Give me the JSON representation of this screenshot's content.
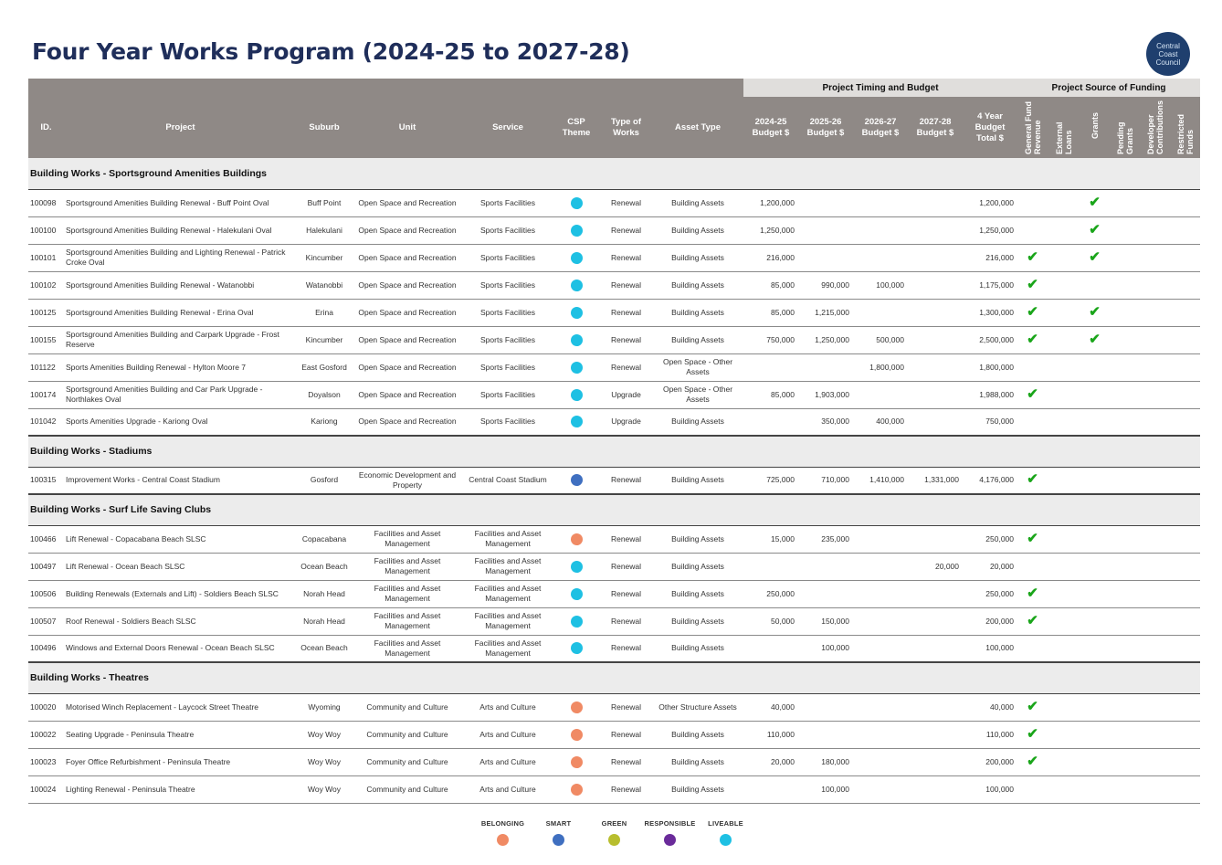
{
  "title": "Four Year Works Program (2024-25 to 2027-28)",
  "logo_text": "Central Coast Council",
  "groups": {
    "timing": "Project Timing and Budget",
    "funding": "Project Source of Funding"
  },
  "headers": {
    "id": "ID.",
    "project": "Project",
    "suburb": "Suburb",
    "unit": "Unit",
    "service": "Service",
    "csp": "CSP Theme",
    "type": "Type of Works",
    "asset": "Asset Type",
    "b1": "2024-25 Budget $",
    "b2": "2025-26 Budget $",
    "b3": "2026-27 Budget $",
    "b4": "2027-28 Budget $",
    "total": "4 Year Budget Total $",
    "f_general": "General Fund Revenue",
    "f_loans": "External Loans",
    "f_grants": "Grants",
    "f_pending": "Pending Grants",
    "f_developer": "Developer Contributions",
    "f_restricted": "Restricted Funds"
  },
  "colors": {
    "BELONGING": "#f08a64",
    "SMART": "#3f6fc0",
    "GREEN": "#b8be2e",
    "RESPONSIBLE": "#6a2b9a",
    "LIVEABLE": "#1ec0e3",
    "tick": "#1aa51a"
  },
  "tick_symbol": "✔",
  "sections": [
    {
      "title": "Building Works - Sportsground Amenities Buildings",
      "rows": [
        {
          "id": "100098",
          "project": "Sportsground Amenities Building Renewal - Buff Point Oval",
          "suburb": "Buff Point",
          "unit": "Open Space and Recreation",
          "service": "Sports Facilities",
          "csp": "LIVEABLE",
          "type": "Renewal",
          "asset": "Building Assets",
          "b1": "1,200,000",
          "b2": "",
          "b3": "",
          "b4": "",
          "total": "1,200,000",
          "funding": [
            false,
            false,
            true,
            false,
            false,
            false
          ]
        },
        {
          "id": "100100",
          "project": "Sportsground Amenities Building Renewal - Halekulani Oval",
          "suburb": "Halekulani",
          "unit": "Open Space and Recreation",
          "service": "Sports Facilities",
          "csp": "LIVEABLE",
          "type": "Renewal",
          "asset": "Building Assets",
          "b1": "1,250,000",
          "b2": "",
          "b3": "",
          "b4": "",
          "total": "1,250,000",
          "funding": [
            false,
            false,
            true,
            false,
            false,
            false
          ]
        },
        {
          "id": "100101",
          "project": "Sportsground Amenities Building and Lighting Renewal - Patrick Croke Oval",
          "suburb": "Kincumber",
          "unit": "Open Space and Recreation",
          "service": "Sports Facilities",
          "csp": "LIVEABLE",
          "type": "Renewal",
          "asset": "Building Assets",
          "b1": "216,000",
          "b2": "",
          "b3": "",
          "b4": "",
          "total": "216,000",
          "funding": [
            true,
            false,
            true,
            false,
            false,
            false
          ]
        },
        {
          "id": "100102",
          "project": "Sportsground Amenities Building Renewal - Watanobbi",
          "suburb": "Watanobbi",
          "unit": "Open Space and Recreation",
          "service": "Sports Facilities",
          "csp": "LIVEABLE",
          "type": "Renewal",
          "asset": "Building Assets",
          "b1": "85,000",
          "b2": "990,000",
          "b3": "100,000",
          "b4": "",
          "total": "1,175,000",
          "funding": [
            true,
            false,
            false,
            false,
            false,
            false
          ]
        },
        {
          "id": "100125",
          "project": "Sportsground Amenities Building Renewal - Erina Oval",
          "suburb": "Erina",
          "unit": "Open Space and Recreation",
          "service": "Sports Facilities",
          "csp": "LIVEABLE",
          "type": "Renewal",
          "asset": "Building Assets",
          "b1": "85,000",
          "b2": "1,215,000",
          "b3": "",
          "b4": "",
          "total": "1,300,000",
          "funding": [
            true,
            false,
            true,
            false,
            false,
            false
          ]
        },
        {
          "id": "100155",
          "project": "Sportsground Amenities Building and Carpark Upgrade - Frost Reserve",
          "suburb": "Kincumber",
          "unit": "Open Space and Recreation",
          "service": "Sports Facilities",
          "csp": "LIVEABLE",
          "type": "Renewal",
          "asset": "Building Assets",
          "b1": "750,000",
          "b2": "1,250,000",
          "b3": "500,000",
          "b4": "",
          "total": "2,500,000",
          "funding": [
            true,
            false,
            true,
            false,
            false,
            false
          ]
        },
        {
          "id": "101122",
          "project": "Sports Amenities Building Renewal - Hylton Moore 7",
          "suburb": "East Gosford",
          "unit": "Open Space and Recreation",
          "service": "Sports Facilities",
          "csp": "LIVEABLE",
          "type": "Renewal",
          "asset": "Open Space - Other Assets",
          "b1": "",
          "b2": "",
          "b3": "1,800,000",
          "b4": "",
          "total": "1,800,000",
          "funding": [
            false,
            false,
            false,
            false,
            false,
            false
          ]
        },
        {
          "id": "100174",
          "project": "Sportsground Amenities Building and Car Park Upgrade - Northlakes Oval",
          "suburb": "Doyalson",
          "unit": "Open Space and Recreation",
          "service": "Sports Facilities",
          "csp": "LIVEABLE",
          "type": "Upgrade",
          "asset": "Open Space - Other Assets",
          "b1": "85,000",
          "b2": "1,903,000",
          "b3": "",
          "b4": "",
          "total": "1,988,000",
          "funding": [
            true,
            false,
            false,
            false,
            false,
            false
          ]
        },
        {
          "id": "101042",
          "project": "Sports Amenities Upgrade - Kariong Oval",
          "suburb": "Kariong",
          "unit": "Open Space and Recreation",
          "service": "Sports Facilities",
          "csp": "LIVEABLE",
          "type": "Upgrade",
          "asset": "Building Assets",
          "b1": "",
          "b2": "350,000",
          "b3": "400,000",
          "b4": "",
          "total": "750,000",
          "funding": [
            false,
            false,
            false,
            false,
            false,
            false
          ]
        }
      ]
    },
    {
      "title": "Building Works - Stadiums",
      "rows": [
        {
          "id": "100315",
          "project": "Improvement Works - Central Coast Stadium",
          "suburb": "Gosford",
          "unit": "Economic Development and Property",
          "service": "Central Coast Stadium",
          "csp": "SMART",
          "type": "Renewal",
          "asset": "Building Assets",
          "b1": "725,000",
          "b2": "710,000",
          "b3": "1,410,000",
          "b4": "1,331,000",
          "total": "4,176,000",
          "funding": [
            true,
            false,
            false,
            false,
            false,
            false
          ]
        }
      ]
    },
    {
      "title": "Building Works - Surf Life Saving Clubs",
      "rows": [
        {
          "id": "100466",
          "project": "Lift Renewal - Copacabana Beach SLSC",
          "suburb": "Copacabana",
          "unit": "Facilities and Asset Management",
          "service": "Facilities and Asset Management",
          "csp": "BELONGING",
          "type": "Renewal",
          "asset": "Building Assets",
          "b1": "15,000",
          "b2": "235,000",
          "b3": "",
          "b4": "",
          "total": "250,000",
          "funding": [
            true,
            false,
            false,
            false,
            false,
            false
          ]
        },
        {
          "id": "100497",
          "project": "Lift Renewal - Ocean Beach SLSC",
          "suburb": "Ocean Beach",
          "unit": "Facilities and Asset Management",
          "service": "Facilities and Asset Management",
          "csp": "LIVEABLE",
          "type": "Renewal",
          "asset": "Building Assets",
          "b1": "",
          "b2": "",
          "b3": "",
          "b4": "20,000",
          "total": "20,000",
          "funding": [
            false,
            false,
            false,
            false,
            false,
            false
          ]
        },
        {
          "id": "100506",
          "project": "Building Renewals (Externals and Lift) - Soldiers Beach SLSC",
          "suburb": "Norah Head",
          "unit": "Facilities and Asset Management",
          "service": "Facilities and Asset Management",
          "csp": "LIVEABLE",
          "type": "Renewal",
          "asset": "Building Assets",
          "b1": "250,000",
          "b2": "",
          "b3": "",
          "b4": "",
          "total": "250,000",
          "funding": [
            true,
            false,
            false,
            false,
            false,
            false
          ]
        },
        {
          "id": "100507",
          "project": "Roof Renewal - Soldiers Beach SLSC",
          "suburb": "Norah Head",
          "unit": "Facilities and Asset Management",
          "service": "Facilities and Asset Management",
          "csp": "LIVEABLE",
          "type": "Renewal",
          "asset": "Building Assets",
          "b1": "50,000",
          "b2": "150,000",
          "b3": "",
          "b4": "",
          "total": "200,000",
          "funding": [
            true,
            false,
            false,
            false,
            false,
            false
          ]
        },
        {
          "id": "100496",
          "project": "Windows and External Doors Renewal - Ocean Beach SLSC",
          "suburb": "Ocean Beach",
          "unit": "Facilities and Asset Management",
          "service": "Facilities and Asset Management",
          "csp": "LIVEABLE",
          "type": "Renewal",
          "asset": "Building Assets",
          "b1": "",
          "b2": "100,000",
          "b3": "",
          "b4": "",
          "total": "100,000",
          "funding": [
            false,
            false,
            false,
            false,
            false,
            false
          ]
        }
      ]
    },
    {
      "title": "Building Works - Theatres",
      "rows": [
        {
          "id": "100020",
          "project": "Motorised Winch Replacement - Laycock Street Theatre",
          "suburb": "Wyoming",
          "unit": "Community and Culture",
          "service": "Arts and Culture",
          "csp": "BELONGING",
          "type": "Renewal",
          "asset": "Other Structure Assets",
          "b1": "40,000",
          "b2": "",
          "b3": "",
          "b4": "",
          "total": "40,000",
          "funding": [
            true,
            false,
            false,
            false,
            false,
            false
          ]
        },
        {
          "id": "100022",
          "project": "Seating Upgrade - Peninsula Theatre",
          "suburb": "Woy Woy",
          "unit": "Community and Culture",
          "service": "Arts and Culture",
          "csp": "BELONGING",
          "type": "Renewal",
          "asset": "Building Assets",
          "b1": "110,000",
          "b2": "",
          "b3": "",
          "b4": "",
          "total": "110,000",
          "funding": [
            true,
            false,
            false,
            false,
            false,
            false
          ]
        },
        {
          "id": "100023",
          "project": "Foyer Office Refurbishment - Peninsula Theatre",
          "suburb": "Woy Woy",
          "unit": "Community and Culture",
          "service": "Arts and Culture",
          "csp": "BELONGING",
          "type": "Renewal",
          "asset": "Building Assets",
          "b1": "20,000",
          "b2": "180,000",
          "b3": "",
          "b4": "",
          "total": "200,000",
          "funding": [
            true,
            false,
            false,
            false,
            false,
            false
          ]
        },
        {
          "id": "100024",
          "project": "Lighting Renewal - Peninsula Theatre",
          "suburb": "Woy Woy",
          "unit": "Community and Culture",
          "service": "Arts and Culture",
          "csp": "BELONGING",
          "type": "Renewal",
          "asset": "Building Assets",
          "b1": "",
          "b2": "100,000",
          "b3": "",
          "b4": "",
          "total": "100,000",
          "funding": [
            false,
            false,
            false,
            false,
            false,
            false
          ]
        }
      ]
    }
  ],
  "legend": [
    {
      "label": "BELONGING",
      "color": "#f08a64"
    },
    {
      "label": "SMART",
      "color": "#3f6fc0"
    },
    {
      "label": "GREEN",
      "color": "#b8be2e"
    },
    {
      "label": "RESPONSIBLE",
      "color": "#6a2b9a"
    },
    {
      "label": "LIVEABLE",
      "color": "#1ec0e3"
    }
  ]
}
